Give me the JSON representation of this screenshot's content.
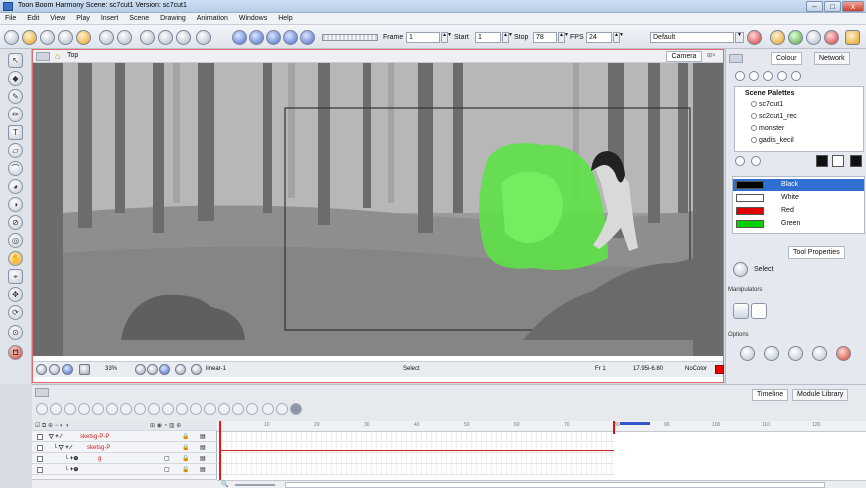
{
  "window": {
    "title": "Toon Boom Harmony Scene: sc7cut1 Version: sc7cut1"
  },
  "menu": [
    "File",
    "Edit",
    "View",
    "Play",
    "Insert",
    "Scene",
    "Drawing",
    "Animation",
    "Windows",
    "Help"
  ],
  "toolbar": {
    "frame_label": "Frame",
    "frame_value": "1",
    "start_label": "Start",
    "start_value": "1",
    "stop_label": "Stop",
    "stop_value": "78",
    "fps_label": "FPS",
    "fps_value": "24",
    "workspace": "Default"
  },
  "viewport": {
    "view_name": "Top",
    "camera_tab": "Camera",
    "zoom": "33%",
    "render_mode": "linear-1",
    "tool": "Select",
    "frame": "Fr 1",
    "coords": "17.95i-6.80",
    "color_status": "NoColor"
  },
  "right_panel": {
    "tabs": [
      "Colour",
      "Network"
    ],
    "palette_header": "Scene Palettes",
    "palettes": [
      "sc7cut1",
      "sc2cut1_rec",
      "monster",
      "gadis_kecil"
    ],
    "colors": [
      {
        "name": "Black",
        "hex": "#000000",
        "selected": true
      },
      {
        "name": "White",
        "hex": "#ffffff",
        "selected": false
      },
      {
        "name": "Red",
        "hex": "#e00000",
        "selected": false
      },
      {
        "name": "Green",
        "hex": "#00d000",
        "selected": false
      }
    ],
    "tool_properties_tab": "Tool Properties",
    "tool_name": "Select",
    "manipulators_label": "Manipulators",
    "options_label": "Options"
  },
  "timeline": {
    "tabs": [
      "Timeline",
      "Module Library"
    ],
    "layers": [
      {
        "name": "sketsg-P-P"
      },
      {
        "name": "sketsg-P"
      },
      {
        "name": "g"
      },
      {
        "name": ""
      }
    ],
    "ruler_ticks": [
      "10",
      "20",
      "30",
      "40",
      "50",
      "60",
      "70",
      "80",
      "90",
      "100",
      "110",
      "120"
    ]
  }
}
